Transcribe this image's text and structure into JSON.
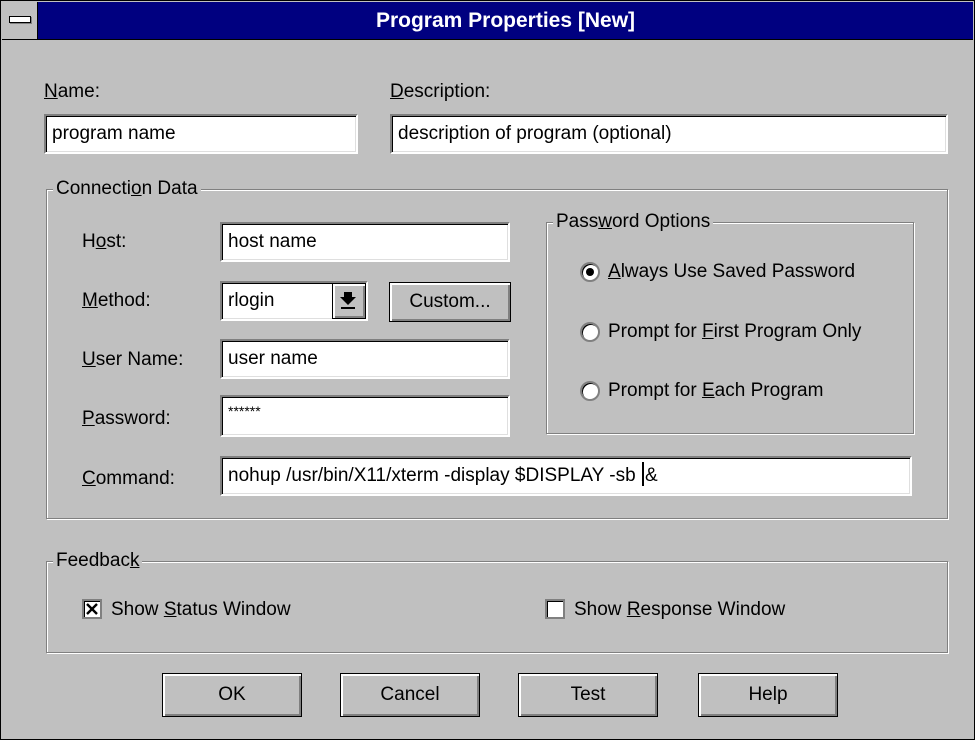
{
  "window": {
    "title": "Program Properties [New]"
  },
  "name": {
    "label_mnemonic": "N",
    "label_rest": "ame:",
    "value": "program name"
  },
  "description": {
    "label_mnemonic": "D",
    "label_rest": "escription:",
    "value": "description of program (optional)"
  },
  "connection": {
    "group_pre": "Connecti",
    "group_mnemonic": "o",
    "group_post": "n Data",
    "host": {
      "pre": "H",
      "mnemonic": "o",
      "post": "st:",
      "value": "host name"
    },
    "method": {
      "pre": "",
      "mnemonic": "M",
      "post": "ethod:",
      "value": "rlogin",
      "custom_label": "Custom..."
    },
    "user": {
      "pre": "",
      "mnemonic": "U",
      "post": "ser Name:",
      "value": "user name"
    },
    "password": {
      "pre": "",
      "mnemonic": "P",
      "post": "assword:",
      "value": "******"
    },
    "command": {
      "pre": "",
      "mnemonic": "C",
      "post": "ommand:",
      "value_before_caret": "nohup /usr/bin/X11/xterm -display $DISPLAY -sb ",
      "value_after_caret": "&"
    }
  },
  "password_options": {
    "group_pre": "Pass",
    "group_mnemonic": "w",
    "group_post": "ord Options",
    "options": [
      {
        "pre": "",
        "mnemonic": "A",
        "post": "lways Use Saved Password",
        "selected": true
      },
      {
        "pre": "Prompt for ",
        "mnemonic": "F",
        "post": "irst Program Only",
        "selected": false
      },
      {
        "pre": "Prompt for ",
        "mnemonic": "E",
        "post": "ach Program",
        "selected": false
      }
    ]
  },
  "feedback": {
    "group_pre": "Feedbac",
    "group_mnemonic": "k",
    "group_post": "",
    "status": {
      "pre": "Show ",
      "mnemonic": "S",
      "post": "tatus Window",
      "checked": true
    },
    "response": {
      "pre": "Show ",
      "mnemonic": "R",
      "post": "esponse Window",
      "checked": false
    }
  },
  "buttons": {
    "ok": "OK",
    "cancel": "Cancel",
    "test": "Test",
    "help": "Help"
  }
}
